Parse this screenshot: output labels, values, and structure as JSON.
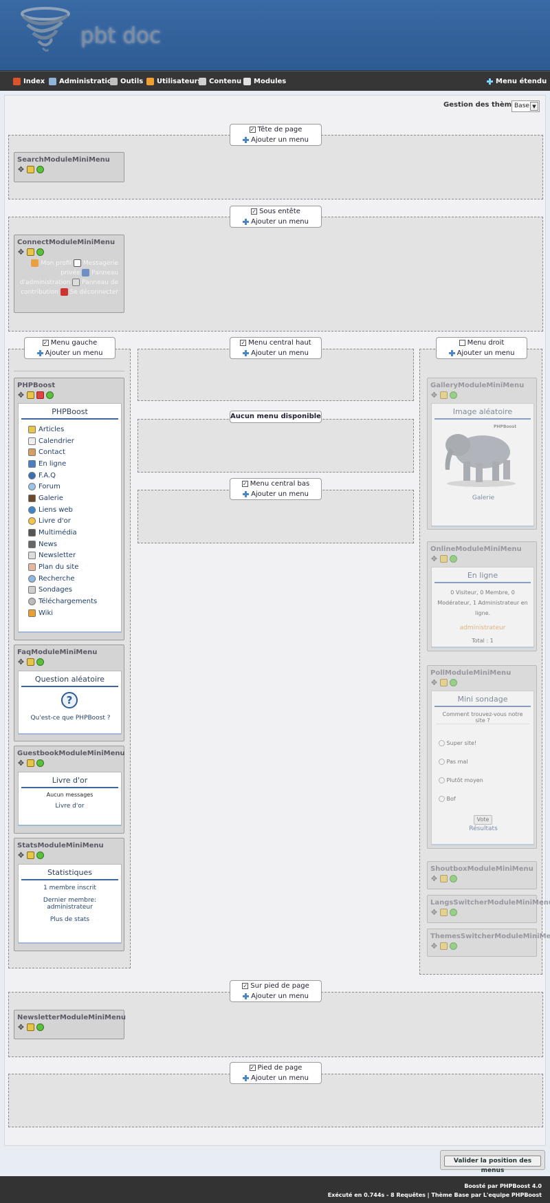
{
  "header": {
    "logo_text": "pbt doc"
  },
  "nav": {
    "items": [
      {
        "label": "Index",
        "icon": "home-icon",
        "color": "#d9532b"
      },
      {
        "label": "Administration",
        "icon": "admin-icon",
        "color": "#8fb3d9"
      },
      {
        "label": "Outils",
        "icon": "tools-icon",
        "color": "#c0c0c0"
      },
      {
        "label": "Utilisateurs",
        "icon": "users-icon",
        "color": "#f0a030"
      },
      {
        "label": "Contenu",
        "icon": "content-icon",
        "color": "#d0d0d0"
      },
      {
        "label": "Modules",
        "icon": "modules-icon",
        "color": "#e0e0e0"
      }
    ],
    "extended": "Menu étendu"
  },
  "theme": {
    "label": "Gestion des thèmes :",
    "value": "Base"
  },
  "add_label": "Ajouter un menu",
  "zones": {
    "tete": {
      "label": "Tête de page",
      "checked": "✓"
    },
    "sous": {
      "label": "Sous entête",
      "checked": "✓"
    },
    "gauche": {
      "label": "Menu gauche",
      "checked": "✓"
    },
    "central_haut": {
      "label": "Menu central haut",
      "checked": "✓"
    },
    "aucun": {
      "label": "Aucun menu disponible"
    },
    "central_bas": {
      "label": "Menu central bas",
      "checked": "✓"
    },
    "droit": {
      "label": "Menu droit",
      "checked": ""
    },
    "sur_pied": {
      "label": "Sur pied de page",
      "checked": "✓"
    },
    "pied": {
      "label": "Pied de page",
      "checked": "✓"
    }
  },
  "modules": {
    "search": {
      "name": "SearchModuleMiniMenu"
    },
    "connect": {
      "name": "ConnectModuleMiniMenu",
      "profile": "Mon profil",
      "messages": "Messagerie privée",
      "admin": "Panneau d'administration",
      "contrib": "Panneau de contribution",
      "logout": "Se déconnecter"
    },
    "phpboost": {
      "name": "PHPBoost",
      "title": "PHPBoost",
      "links": [
        "Articles",
        "Calendrier",
        "Contact",
        "En ligne",
        "F.A.Q",
        "Forum",
        "Galerie",
        "Liens web",
        "Livre d'or",
        "Multimédia",
        "News",
        "Newsletter",
        "Plan du site",
        "Recherche",
        "Sondages",
        "Téléchargements",
        "Wiki"
      ]
    },
    "faq": {
      "name": "FaqModuleMiniMenu",
      "title": "Question aléatoire",
      "question": "Qu'est-ce que PHPBoost ?"
    },
    "guestbook": {
      "name": "GuestbookModuleMiniMenu",
      "title": "Livre d'or",
      "empty": "Aucun messages",
      "link": "Livre d'or"
    },
    "stats": {
      "name": "StatsModuleMiniMenu",
      "title": "Statistiques",
      "members": "1 membre inscrit",
      "last_label": "Dernier membre:",
      "last_user": "administrateur",
      "more": "Plus de stats"
    },
    "gallery": {
      "name": "GalleryModuleMiniMenu",
      "title": "Image aléatoire",
      "image_badge": "PHPBoost",
      "link": "Galerie"
    },
    "online": {
      "name": "OnlineModuleMiniMenu",
      "title": "En ligne",
      "info": "0 Visiteur, 0 Membre, 0 Modérateur, 1 Administrateur en ligne.",
      "user": "administrateur",
      "total": "Total : 1"
    },
    "poll": {
      "name": "PollModuleMiniMenu",
      "title": "Mini sondage",
      "question": "Comment trouvez-vous notre site ?",
      "options": [
        "Super site!",
        "Pas mal",
        "Plutôt moyen",
        "Bof"
      ],
      "vote": "Vote",
      "results": "Résultats"
    },
    "shoutbox": {
      "name": "ShoutboxModuleMiniMenu"
    },
    "langs": {
      "name": "LangsSwitcherModuleMiniMenu"
    },
    "themes": {
      "name": "ThemesSwitcherModuleMiniMenu"
    },
    "newsletter": {
      "name": "NewsletterModuleMiniMenu"
    }
  },
  "validate": "Valider la position des menus",
  "footer": {
    "line1": "Boosté par PHPBoost 4.0",
    "line2": "Exécuté en 0.744s - 8 Requêtes | Thème Base par L'equipe PHPBoost"
  }
}
